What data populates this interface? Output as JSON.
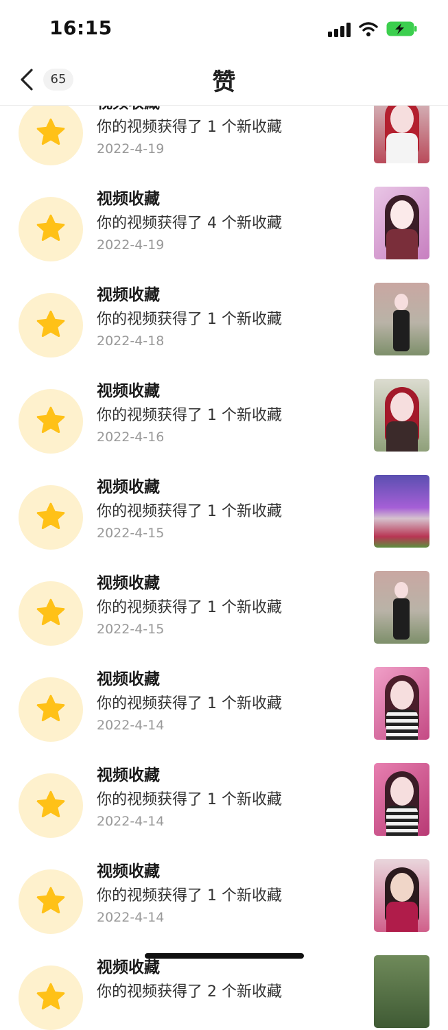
{
  "status_bar": {
    "time": "16:15"
  },
  "header": {
    "back_count": "65",
    "title": "赞"
  },
  "colors": {
    "star": "#ffc117",
    "star_bg": "#fef1cd",
    "date": "#999999"
  },
  "icons": {
    "back": "chevron-left-icon",
    "star": "star-icon"
  },
  "items": [
    {
      "title": "视频收藏",
      "desc": "你的视频获得了 1 个新收藏",
      "date": "2022-4-19"
    },
    {
      "title": "视频收藏",
      "desc": "你的视频获得了 4 个新收藏",
      "date": "2022-4-19"
    },
    {
      "title": "视频收藏",
      "desc": "你的视频获得了 1 个新收藏",
      "date": "2022-4-18"
    },
    {
      "title": "视频收藏",
      "desc": "你的视频获得了 1 个新收藏",
      "date": "2022-4-16"
    },
    {
      "title": "视频收藏",
      "desc": "你的视频获得了 1 个新收藏",
      "date": "2022-4-15"
    },
    {
      "title": "视频收藏",
      "desc": "你的视频获得了 1 个新收藏",
      "date": "2022-4-15"
    },
    {
      "title": "视频收藏",
      "desc": "你的视频获得了 1 个新收藏",
      "date": "2022-4-14"
    },
    {
      "title": "视频收藏",
      "desc": "你的视频获得了 1 个新收藏",
      "date": "2022-4-14"
    },
    {
      "title": "视频收藏",
      "desc": "你的视频获得了 1 个新收藏",
      "date": "2022-4-14"
    },
    {
      "title": "视频收藏",
      "desc": "你的视频获得了 2 个新收藏",
      "date": ""
    }
  ]
}
